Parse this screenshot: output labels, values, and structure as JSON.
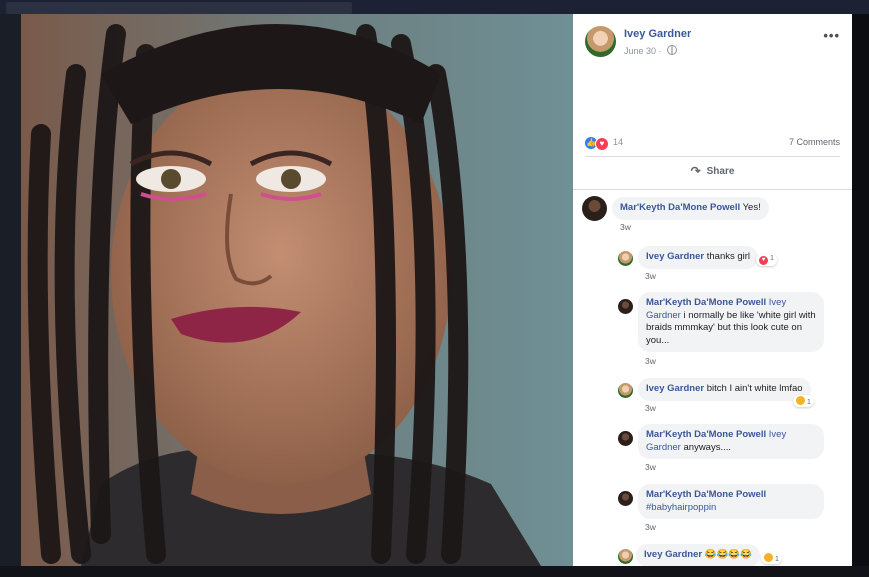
{
  "post": {
    "author": "Ivey Gardner",
    "date": "June 30",
    "more_label": "•••",
    "reaction_count": "14",
    "comment_count": "7 Comments",
    "share_label": "Share"
  },
  "comments": [
    {
      "name": "Mar'Keyth Da'Mone Powell",
      "text": "Yes!",
      "time": "3w"
    },
    {
      "name": "Ivey Gardner",
      "text": "thanks girl",
      "time": "3w",
      "reaction_count": "1"
    },
    {
      "name": "Mar'Keyth Da'Mone Powell",
      "tag": "Ivey Gardner",
      "text": "i normally be like 'white girl with braids mmmkay' but this look cute on you...",
      "time": "3w"
    },
    {
      "name": "Ivey Gardner",
      "text": "bitch I ain't white lmfao",
      "time": "3w",
      "reaction_count": "1"
    },
    {
      "name": "Mar'Keyth Da'Mone Powell",
      "tag": "Ivey Gardner",
      "text": "anyways....",
      "time": "3w"
    },
    {
      "name": "Mar'Keyth Da'Mone Powell",
      "text": "#babyhairpoppin",
      "time": "3w"
    },
    {
      "name": "Ivey Gardner",
      "text": "😂😂😂😂",
      "reaction_count": "1"
    }
  ],
  "colors": {
    "link": "#385898",
    "like": "#2e7df6",
    "love": "#f33e58",
    "bubble": "#f2f3f5"
  },
  "icons": [
    "globe-icon",
    "like-icon",
    "love-icon",
    "share-icon",
    "haha-icon",
    "sad-icon"
  ]
}
